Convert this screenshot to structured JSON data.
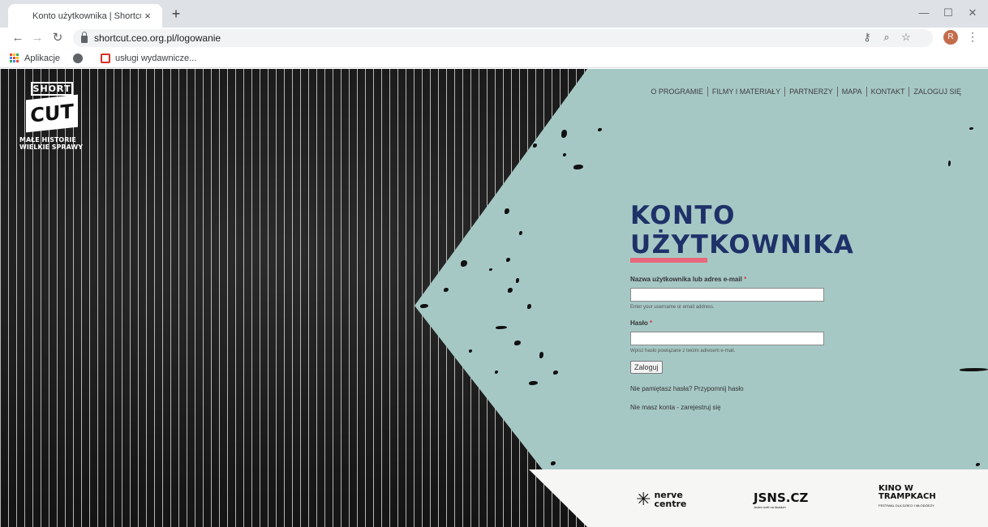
{
  "browser": {
    "tab_title": "Konto użytkownika | Shortcut",
    "tab_close": "×",
    "new_tab": "+",
    "url": "shortcut.ceo.org.pl/logowanie",
    "profile_initial": "R",
    "bookmarks": [
      {
        "label": "Aplikacje",
        "icon": "apps-icon"
      },
      {
        "label": "",
        "icon": "globe-icon"
      },
      {
        "label": "usługi wydawnicze...",
        "icon": "publishing-icon"
      }
    ]
  },
  "logo": {
    "top": "SHORT",
    "main": "CUT",
    "tagline_1": "MAŁE HISTORIE",
    "tagline_2": "WIELKIE SPRAWY"
  },
  "nav": {
    "items": [
      "O PROGRAMIE",
      "FILMY I MATERIAŁY",
      "PARTNERZY",
      "MAPA",
      "KONTAKT",
      "ZALOGUJ SIĘ"
    ]
  },
  "login": {
    "title": "KONTO UŻYTKOWNIKA",
    "username_label": "Nazwa użytkownika lub adres e-mail",
    "required_mark": "*",
    "username_value": "",
    "username_hint": "Enter your username or email address.",
    "password_label": "Hasło",
    "password_value": "",
    "password_hint": "Wpisz hasło powiązane z twoim adresem e-mail.",
    "submit": "Zaloguj",
    "forgot": "Nie pamiętasz hasła? Przypomnij hasło",
    "register": "Nie masz konta - zarejestruj się"
  },
  "partners": {
    "nerve_1": "nerve",
    "nerve_2": "centre",
    "jsns": "JSNS.CZ",
    "jsns_sub": "Jeden svět na školách",
    "kino_1": "KINO W",
    "kino_2": "TRAMPKACH",
    "kino_sub": "FESTIWAL DLA DZIECI I MŁODZIEŻY"
  },
  "colors": {
    "teal": "#a6c8c5",
    "title_navy": "#1e3168",
    "accent_pink": "#e8677b",
    "dark": "#161616"
  }
}
